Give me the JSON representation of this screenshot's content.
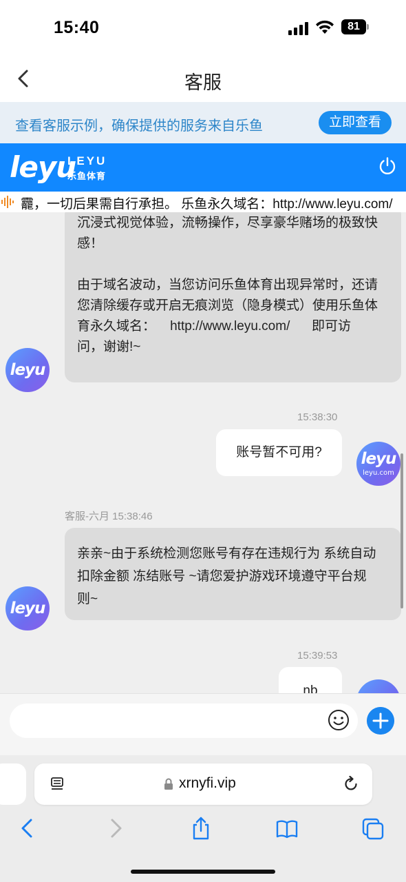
{
  "status_bar": {
    "time": "15:40",
    "battery": "81"
  },
  "nav": {
    "title": "客服"
  },
  "banner": {
    "text": "查看客服示例，确保提供的服务来自乐鱼",
    "button_label": "立即查看"
  },
  "brand": {
    "logo": "leyu",
    "logo_en": "LEYU",
    "logo_cn": "乐鱼体育"
  },
  "marquee": {
    "text": "龗，一切后果需自行承担。 乐鱼永久域名：http://www.leyu.com/"
  },
  "chat": {
    "messages": [
      {
        "side": "agent",
        "lines": [
          "沉浸式视觉体验，流畅操作，尽享豪华赌场的极致快",
          "感！",
          "",
          "由于域名波动，当您访问乐鱼体育出现异常时，还请",
          "您清除缓存或开启无痕浏览（隐身模式）使用乐鱼体",
          "育永久域名：    http://www.leyu.com/      即可访",
          "问，谢谢!~"
        ],
        "avatar": "leyu"
      },
      {
        "side": "user",
        "timestamp": "15:38:30",
        "text": "账号暂不可用?",
        "avatar": "leyu",
        "avatar_sub": "leyu.com"
      },
      {
        "side": "agent",
        "sender": "客服-六月",
        "timestamp": "15:38:46",
        "lines": [
          "亲亲~由于系统检测您账号有存在违规行为 系统自动",
          "扣除金额 冻结账号 ~请您爱护游戏环境遵守平台规",
          "则~"
        ],
        "avatar": "leyu"
      },
      {
        "side": "user",
        "timestamp": "15:39:53",
        "text": "nb"
      }
    ]
  },
  "input": {
    "placeholder": ""
  },
  "safari": {
    "url": "xrnyfi.vip"
  },
  "icons": [
    "back-chevron-icon",
    "power-icon",
    "sound-wave-icon",
    "emoji-icon",
    "plus-icon",
    "lock-icon",
    "reader-icon",
    "reload-icon",
    "share-icon",
    "bookmarks-icon",
    "tabs-icon",
    "forward-chevron-icon"
  ],
  "colors": {
    "brand_blue": "#1188ff",
    "banner_bg": "#e8eff6",
    "banner_text": "#2e86c9",
    "chat_bg": "#efefef",
    "agent_bubble": "#dcdcdc"
  }
}
